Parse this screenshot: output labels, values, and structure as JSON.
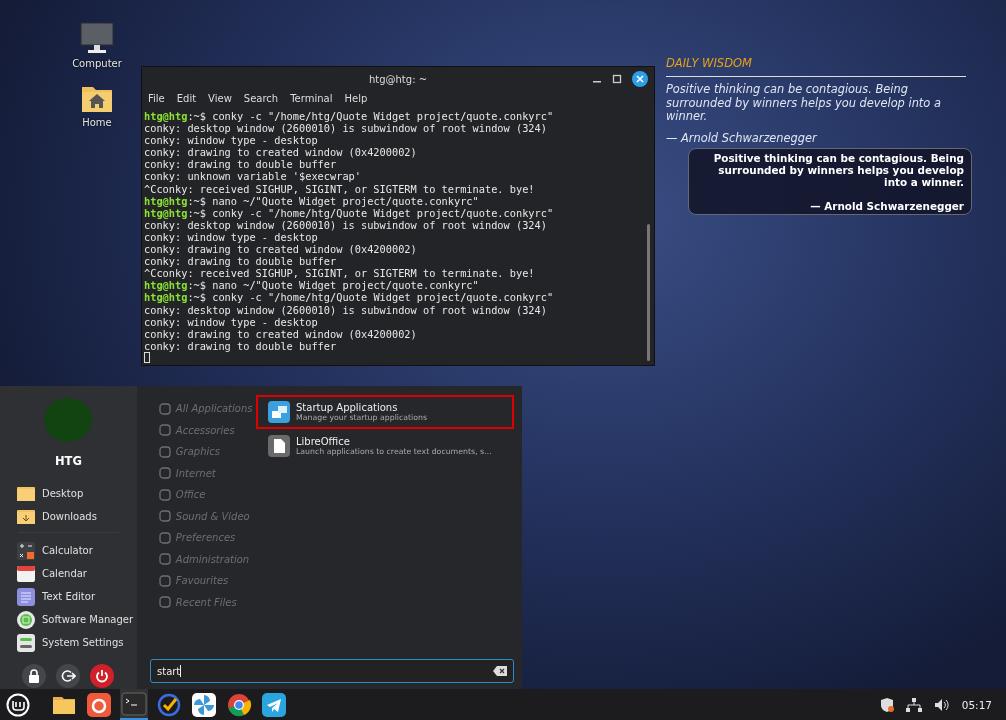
{
  "desktop_icons": [
    {
      "kind": "computer",
      "label": "Computer"
    },
    {
      "kind": "home",
      "label": "Home"
    }
  ],
  "terminal": {
    "title": "htg@htg: ~",
    "menu": [
      "File",
      "Edit",
      "View",
      "Search",
      "Terminal",
      "Help"
    ],
    "lines": [
      {
        "kind": "prompt",
        "prompt": "htg@htg",
        "text": ":~$ conky -c \"/home/htg/Quote Widget project/quote.conkyrc\""
      },
      {
        "kind": "output",
        "text": "conky: desktop window (2600010) is subwindow of root window (324)"
      },
      {
        "kind": "output",
        "text": "conky: window type - desktop"
      },
      {
        "kind": "output",
        "text": "conky: drawing to created window (0x4200002)"
      },
      {
        "kind": "output",
        "text": "conky: drawing to double buffer"
      },
      {
        "kind": "output",
        "text": "conky: unknown variable '$execwrap'"
      },
      {
        "kind": "output",
        "text": "^Cconky: received SIGHUP, SIGINT, or SIGTERM to terminate. bye!"
      },
      {
        "kind": "prompt",
        "prompt": "htg@htg",
        "text": ":~$ nano ~/\"Quote Widget project/quote.conkyrc\""
      },
      {
        "kind": "prompt",
        "prompt": "htg@htg",
        "text": ":~$ conky -c \"/home/htg/Quote Widget project/quote.conkyrc\""
      },
      {
        "kind": "output",
        "text": "conky: desktop window (2600010) is subwindow of root window (324)"
      },
      {
        "kind": "output",
        "text": "conky: window type - desktop"
      },
      {
        "kind": "output",
        "text": "conky: drawing to created window (0x4200002)"
      },
      {
        "kind": "output",
        "text": "conky: drawing to double buffer"
      },
      {
        "kind": "output",
        "text": "^Cconky: received SIGHUP, SIGINT, or SIGTERM to terminate. bye!"
      },
      {
        "kind": "prompt",
        "prompt": "htg@htg",
        "text": ":~$ nano ~/\"Quote Widget project/quote.conkyrc\""
      },
      {
        "kind": "prompt",
        "prompt": "htg@htg",
        "text": ":~$ conky -c \"/home/htg/Quote Widget project/quote.conkyrc\""
      },
      {
        "kind": "output",
        "text": "conky: desktop window (2600010) is subwindow of root window (324)"
      },
      {
        "kind": "output",
        "text": "conky: window type - desktop"
      },
      {
        "kind": "output",
        "text": "conky: drawing to created window (0x4200002)"
      },
      {
        "kind": "output",
        "text": "conky: drawing to double buffer"
      }
    ]
  },
  "quote_widget": {
    "heading": "DAILY WISDOM",
    "quote": "Positive thinking can be contagious. Being surrounded by winners helps you develop into a winner.",
    "author": "— Arnold Schwarzenegger"
  },
  "quote_card": {
    "quote": "Positive thinking can be contagious. Being surrounded by winners helps you develop into a winner.",
    "author": "— Arnold Schwarzenegger"
  },
  "menu": {
    "user": "HTG",
    "places": [
      {
        "kind": "folder",
        "label": "Desktop"
      },
      {
        "kind": "downloads",
        "label": "Downloads"
      }
    ],
    "favorites": [
      {
        "kind": "calculator",
        "label": "Calculator"
      },
      {
        "kind": "calendar",
        "label": "Calendar"
      },
      {
        "kind": "editor",
        "label": "Text Editor"
      },
      {
        "kind": "software",
        "label": "Software Manager"
      },
      {
        "kind": "settings",
        "label": "System Settings"
      }
    ],
    "session_buttons": [
      {
        "kind": "lock"
      },
      {
        "kind": "logout"
      },
      {
        "kind": "power"
      }
    ],
    "categories": [
      {
        "label": "All Applications",
        "disabled": true
      },
      {
        "label": "Accessories",
        "disabled": true
      },
      {
        "label": "Graphics",
        "disabled": true
      },
      {
        "label": "Internet",
        "disabled": true
      },
      {
        "label": "Office",
        "disabled": true
      },
      {
        "label": "Sound & Video",
        "disabled": true
      },
      {
        "label": "Preferences",
        "disabled": true
      },
      {
        "label": "Administration",
        "disabled": true
      },
      {
        "label": "Favourites",
        "disabled": true
      },
      {
        "label": "Recent Files",
        "disabled": true
      }
    ],
    "results": [
      {
        "kind": "startup",
        "name": "Startup Applications",
        "description": "Manage your startup applications",
        "highlighted": true
      },
      {
        "kind": "office",
        "name": "LibreOffice",
        "description": "Launch applications to create text documents, s…",
        "highlighted": false
      }
    ],
    "search": {
      "value": "start"
    }
  },
  "taskbar": {
    "apps": [
      {
        "kind": "files",
        "active": false
      },
      {
        "kind": "browser",
        "active": false
      },
      {
        "kind": "terminal",
        "active": true
      },
      {
        "kind": "tasks",
        "active": false
      },
      {
        "kind": "app",
        "active": false
      },
      {
        "kind": "chrome",
        "active": false
      },
      {
        "kind": "telegram",
        "active": false
      }
    ],
    "clock": "05:17"
  }
}
